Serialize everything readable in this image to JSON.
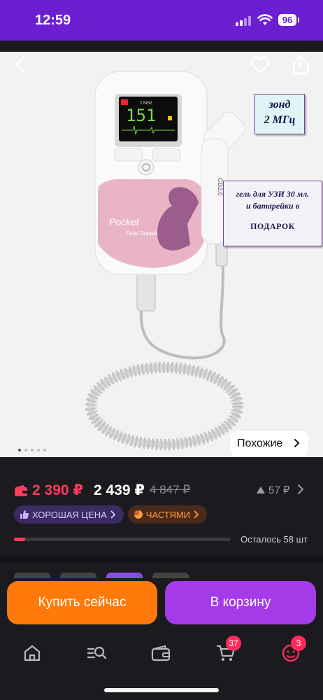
{
  "status_bar": {
    "time": "12:59",
    "battery": "96"
  },
  "image": {
    "device_screen_text": "151",
    "device_brand": "Pocket",
    "device_subtitle": "Fetal Doppler",
    "probe_label": "CD2.0",
    "promo_probe": {
      "line1": "зонд",
      "line2": "2 МГц"
    },
    "promo_gift": {
      "line1": "гель для УЗИ 30 мл.",
      "line2": "и батарейки в",
      "line3": "ПОДАРОК"
    },
    "similar_label": "Похожие",
    "dots_total": 5,
    "dots_active": 0
  },
  "price": {
    "card_price": "2 390 ₽",
    "price": "2 439 ₽",
    "old_price": "4 847 ₽",
    "bonus": "57 ₽"
  },
  "badges": {
    "good_price": "ХОРОШАЯ ЦЕНА",
    "installments": "ЧАСТЯМИ"
  },
  "stock": {
    "label": "Осталось 58 шт",
    "level": 0.05
  },
  "actions": {
    "buy_now": "Купить сейчас",
    "add_to_cart": "В корзину"
  },
  "nav": {
    "cart_count": "37",
    "profile_count": "3"
  },
  "colors": {
    "brand_purple": "#6b1fd1",
    "buy_orange": "#ff7a0a",
    "cart_purple": "#a43ae8",
    "price_red": "#ff3b5c"
  }
}
